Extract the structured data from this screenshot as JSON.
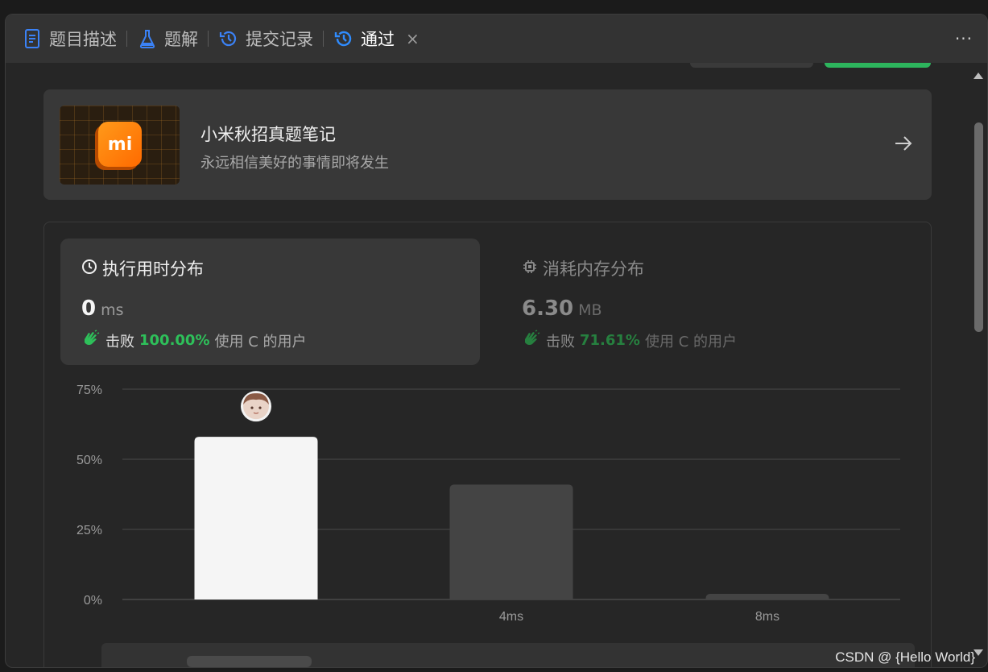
{
  "tabs": [
    {
      "label": "题目描述",
      "icon": "document-icon"
    },
    {
      "label": "题解",
      "icon": "flask-icon"
    },
    {
      "label": "提交记录",
      "icon": "history-icon"
    },
    {
      "label": "通过",
      "icon": "history-icon",
      "active": true
    }
  ],
  "tab_close": "×",
  "more_menu": "···",
  "promo": {
    "logo_text": "mi",
    "title": "小米秋招真题笔记",
    "subtitle": "永远相信美好的事情即将发生"
  },
  "runtime": {
    "heading": "执行用时分布",
    "value": "0",
    "unit": "ms",
    "beat_label": "击败",
    "beat_pct": "100.00%",
    "beat_rest": "使用 C 的用户"
  },
  "memory": {
    "heading": "消耗内存分布",
    "value": "6.30",
    "unit": "MB",
    "beat_label": "击败",
    "beat_pct": "71.61%",
    "beat_rest": "使用 C 的用户"
  },
  "chart_data": {
    "type": "bar",
    "categories": [
      "",
      "4ms",
      "8ms"
    ],
    "values": [
      58,
      41,
      2
    ],
    "y_ticks": [
      "0%",
      "25%",
      "50%",
      "75%"
    ],
    "ylim": [
      0,
      75
    ],
    "highlight_index": 0,
    "colors": {
      "highlight": "#f5f5f5",
      "normal": "#444444",
      "grid": "#4a4a4a"
    }
  },
  "watermark": "CSDN @ {Hello World}"
}
